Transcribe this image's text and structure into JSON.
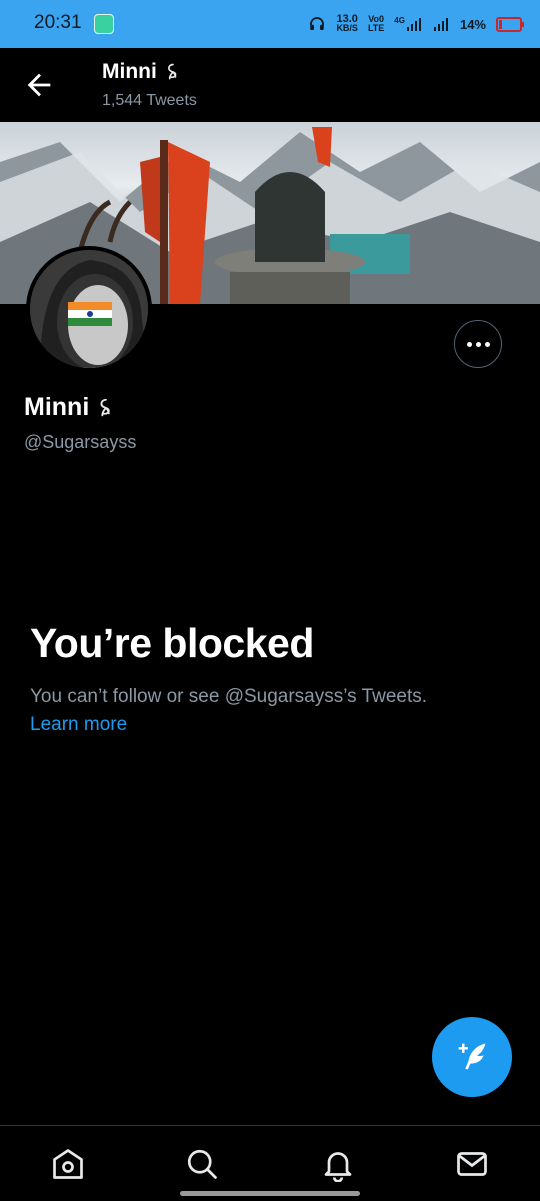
{
  "status_bar": {
    "time": "20:31",
    "net_speed_value": "13.0",
    "net_speed_unit": "KB/S",
    "volte_top": "Vo0",
    "volte_bottom": "LTE",
    "network": "4G",
    "battery": "14%"
  },
  "header": {
    "name": "Minni",
    "tweet_count": "1,544 Tweets"
  },
  "profile": {
    "name": "Minni",
    "handle": "@Sugarsayss"
  },
  "blocked": {
    "title": "You’re blocked",
    "description": "You can’t follow or see @Sugarsayss’s Tweets.",
    "link": "Learn more"
  },
  "colors": {
    "accent": "#1d9bf0",
    "status_bar": "#3aa4f0",
    "secondary_text": "#8b98a5"
  },
  "icons": {
    "back": "arrow-left-icon",
    "more": "more-dots-icon",
    "compose": "compose-feather-icon",
    "nav": [
      "home-icon",
      "search-icon",
      "bell-icon",
      "mail-icon"
    ]
  }
}
